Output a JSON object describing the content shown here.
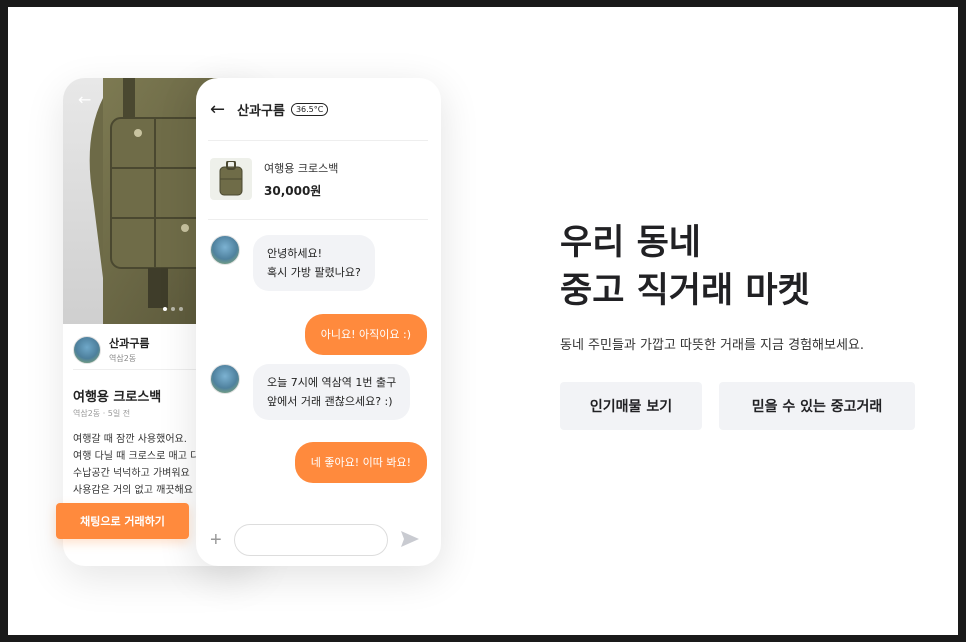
{
  "product": {
    "seller_name": "산과구름",
    "seller_location": "역삼2동",
    "title": "여행용 크로스백",
    "meta": "역삼2동 · 5일 전",
    "description_lines": [
      "여행갈 때 잠깐 사용했어요.",
      "여행 다닐 때 크로스로 매고 다",
      "수납공간 넉넉하고 가벼워요",
      "사용감은 거의 없고 깨끗해요"
    ],
    "cta_label": "채팅으로 거래하기"
  },
  "chat": {
    "partner_name": "산과구름",
    "manner_temp": "36.5°C",
    "item_name": "여행용 크로스백",
    "item_price": "30,000원",
    "messages": [
      {
        "side": "in",
        "lines": [
          "안녕하세요!",
          "혹시 가방 팔렸나요?"
        ]
      },
      {
        "side": "out",
        "lines": [
          "아니요! 아직이요 :)"
        ]
      },
      {
        "side": "in",
        "lines": [
          "오늘 7시에 역삼역 1번 출구",
          "앞에서 거래 괜찮으세요? :)"
        ]
      },
      {
        "side": "out",
        "lines": [
          "네 좋아요! 이따 봐요!"
        ]
      }
    ],
    "input_placeholder": ""
  },
  "hero": {
    "title_line1": "우리 동네",
    "title_line2": "중고 직거래 마켓",
    "subtitle": "동네 주민들과 가깝고 따뜻한 거래를 지금 경험해보세요.",
    "btn_popular": "인기매물 보기",
    "btn_trust": "믿을 수 있는 중고거래"
  },
  "colors": {
    "accent": "#ff8a3d",
    "button_bg": "#f2f3f6",
    "text_dark": "#212124"
  },
  "icons": {
    "back": "arrow-left-icon",
    "plus": "plus-icon",
    "send": "send-icon"
  }
}
